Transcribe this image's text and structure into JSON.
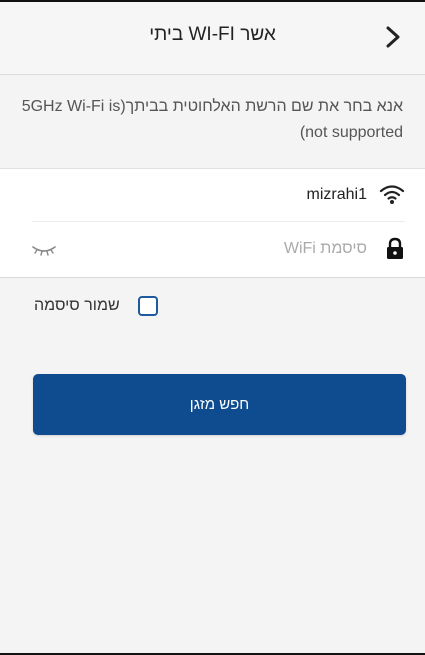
{
  "header": {
    "title": "אשר WI-FI ביתי",
    "back_icon": "chevron-right-icon"
  },
  "description": {
    "text": "אנא בחר את שם הרשת האלחוטית בביתך(5GHz Wi-Fi is not supported)"
  },
  "network": {
    "ssid": "mizrahi1",
    "wifi_icon": "wifi-icon"
  },
  "password": {
    "placeholder": "סיסמת WiFi",
    "value": "",
    "lock_icon": "lock-icon",
    "toggle_icon": "eye-closed-icon"
  },
  "save_password": {
    "label": "שמור סיסמה",
    "checked": false
  },
  "primary_button": {
    "label": "חפש מזגן"
  },
  "colors": {
    "accent": "#0e4c8f",
    "checkbox_border": "#1e5aa0",
    "background": "#f4f4f4",
    "card": "#ffffff"
  }
}
